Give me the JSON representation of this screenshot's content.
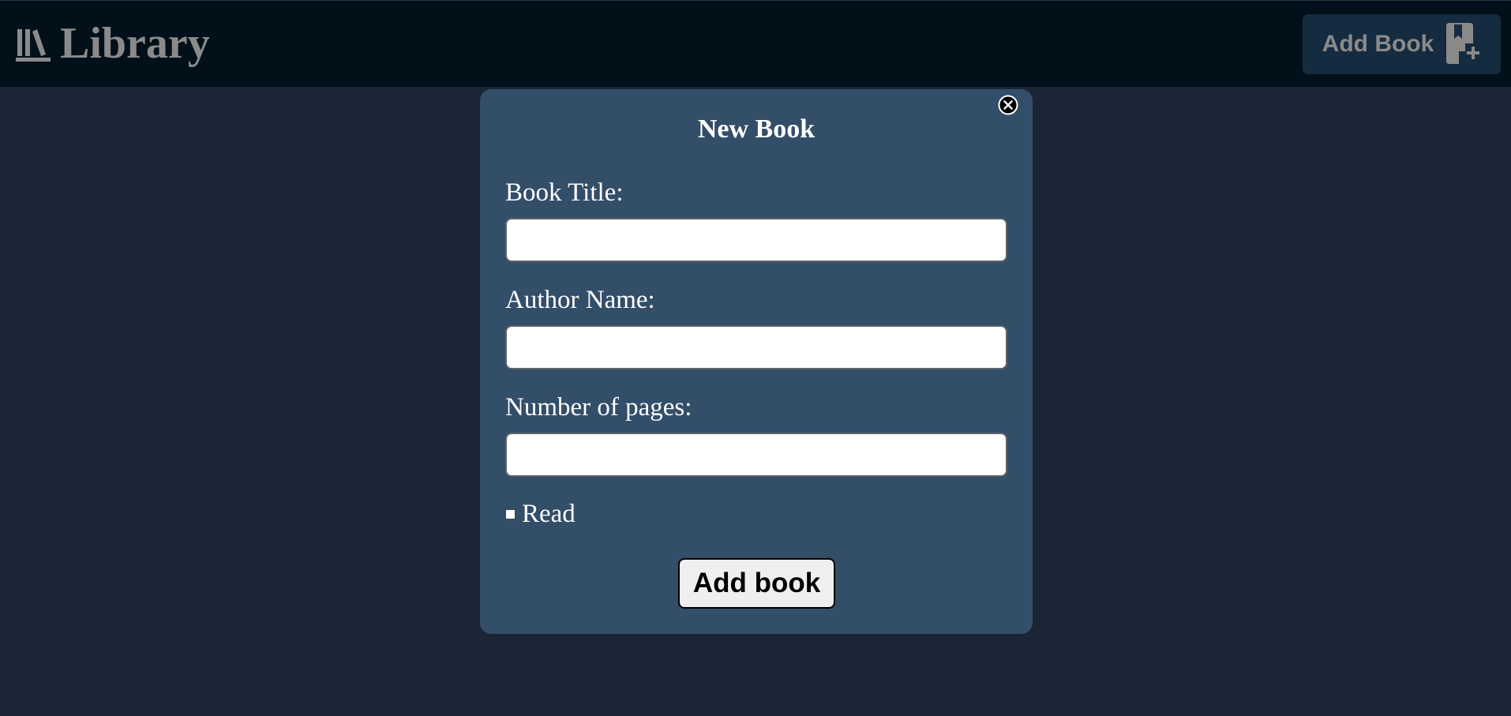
{
  "header": {
    "brand_icon": "books-icon",
    "title": "Library",
    "add_button": {
      "label": "Add Book",
      "icon": "bookmark-plus-icon"
    }
  },
  "modal": {
    "title": "New Book",
    "close_icon": "close-circle-icon",
    "fields": [
      {
        "label": "Book Title:",
        "value": "",
        "placeholder": ""
      },
      {
        "label": "Author Name:",
        "value": "",
        "placeholder": ""
      },
      {
        "label": "Number of pages:",
        "value": "",
        "placeholder": ""
      }
    ],
    "read_checkbox": {
      "label": "Read",
      "checked": false
    },
    "submit_label": "Add book"
  },
  "colors": {
    "page_background": "#1b2535",
    "topbar_background": "#02101a",
    "modal_background": "#334e69",
    "header_text": "#8a8a8a",
    "header_button_background": "#152b40"
  }
}
